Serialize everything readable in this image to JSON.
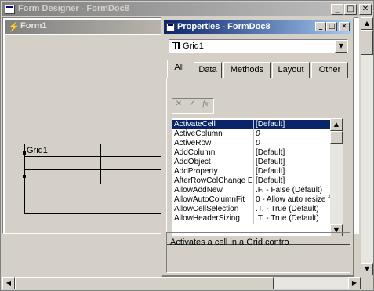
{
  "designer": {
    "title": "Form Designer - FormDoc8",
    "minimize_glyph": "_",
    "maximize_glyph": "□",
    "close_glyph": "✕"
  },
  "form": {
    "title": "Form1",
    "fox_glyph": "⚡",
    "grid_caption": "Grid1"
  },
  "scroll": {
    "up_glyph": "▲",
    "down_glyph": "▼",
    "left_glyph": "◀",
    "right_glyph": "▶"
  },
  "properties": {
    "title": "Properties - FormDoc8",
    "object_selector_value": "Grid1",
    "combo_arrow": "▼",
    "tabs": [
      "All",
      "Data",
      "Methods",
      "Layout",
      "Other"
    ],
    "active_tab": "All",
    "toolbar": {
      "cancel_glyph": "✕",
      "accept_glyph": "✓",
      "fx_glyph": "fx"
    },
    "rows": [
      {
        "name": "ActivateCell",
        "value": "[Default]"
      },
      {
        "name": "ActiveColumn",
        "value": "0"
      },
      {
        "name": "ActiveRow",
        "value": "0"
      },
      {
        "name": "AddColumn",
        "value": "[Default]"
      },
      {
        "name": "AddObject",
        "value": "[Default]"
      },
      {
        "name": "AddProperty",
        "value": "[Default]"
      },
      {
        "name": "AfterRowColChange Ev",
        "value": "[Default]"
      },
      {
        "name": "AllowAddNew",
        "value": ".F. - False (Default)"
      },
      {
        "name": "AllowAutoColumnFit",
        "value": "0 - Allow auto resize fo"
      },
      {
        "name": "AllowCellSelection",
        "value": ".T. - True (Default)"
      },
      {
        "name": "AllowHeaderSizing",
        "value": ".T. - True (Default)"
      }
    ],
    "description": "Activates a cell in a Grid contro"
  }
}
